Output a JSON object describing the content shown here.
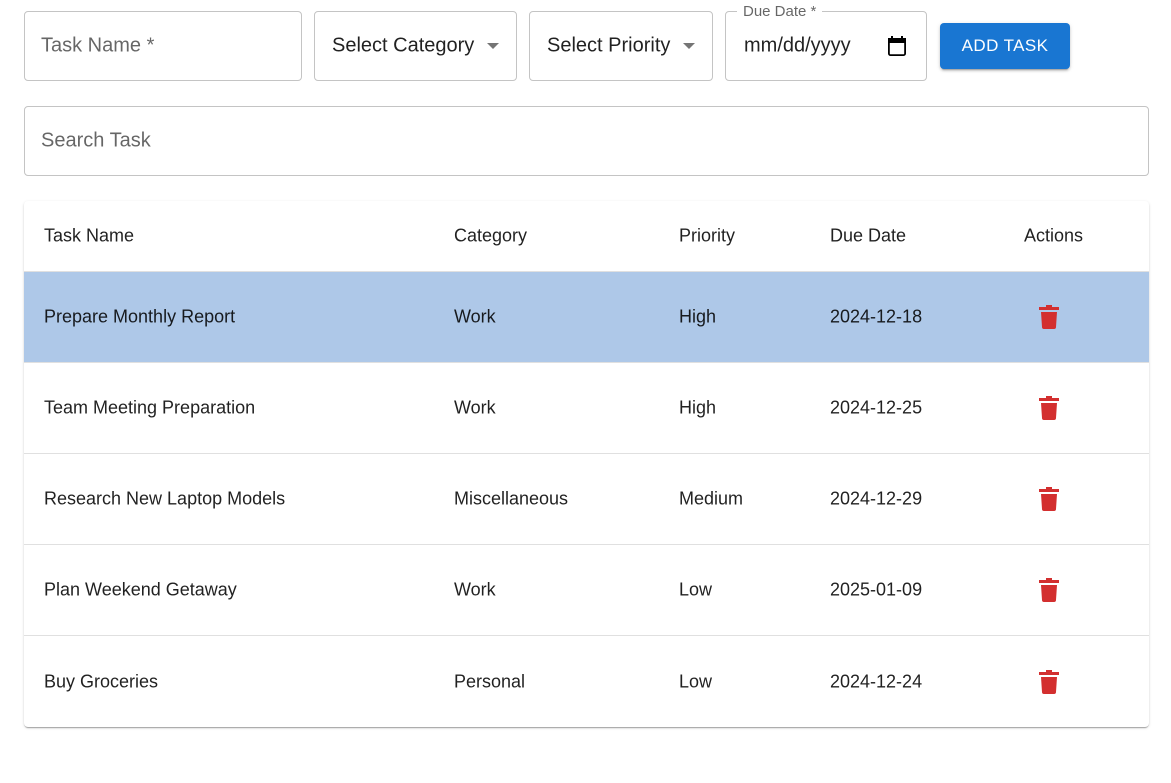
{
  "form": {
    "task_name_placeholder": "Task Name *",
    "category_placeholder": "Select Category",
    "priority_placeholder": "Select Priority",
    "due_date_label": "Due Date *",
    "due_date_value": "mm/dd/yyyy",
    "add_button_label": "ADD TASK"
  },
  "search": {
    "placeholder": "Search Task"
  },
  "table": {
    "headers": {
      "task_name": "Task Name",
      "category": "Category",
      "priority": "Priority",
      "due_date": "Due Date",
      "actions": "Actions"
    },
    "rows": [
      {
        "name": "Prepare Monthly Report",
        "category": "Work",
        "priority": "High",
        "due": "2024-12-18",
        "selected": true
      },
      {
        "name": "Team Meeting Preparation",
        "category": "Work",
        "priority": "High",
        "due": "2024-12-25",
        "selected": false
      },
      {
        "name": "Research New Laptop Models",
        "category": "Miscellaneous",
        "priority": "Medium",
        "due": "2024-12-29",
        "selected": false
      },
      {
        "name": "Plan Weekend Getaway",
        "category": "Work",
        "priority": "Low",
        "due": "2025-01-09",
        "selected": false
      },
      {
        "name": "Buy Groceries",
        "category": "Personal",
        "priority": "Low",
        "due": "2024-12-24",
        "selected": false
      }
    ]
  },
  "icons": {
    "delete": "delete-icon",
    "calendar": "calendar-icon",
    "dropdown": "chevron-down-icon"
  },
  "colors": {
    "primary": "#1976d2",
    "selected_row": "#aec8e8",
    "delete_icon": "#d32f2f"
  }
}
